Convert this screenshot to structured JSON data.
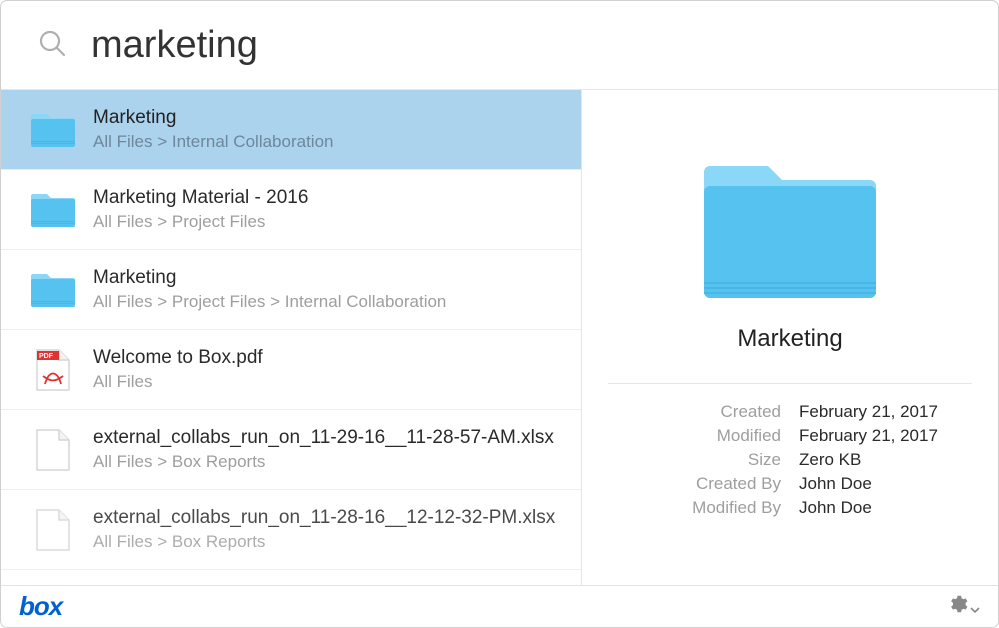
{
  "search": {
    "query": "marketing",
    "placeholder": ""
  },
  "icons": {
    "search": "search-icon",
    "gear": "gear-icon"
  },
  "results": [
    {
      "type": "folder",
      "title": "Marketing",
      "path": "All Files > Internal Collaboration",
      "selected": true
    },
    {
      "type": "folder",
      "title": "Marketing Material - 2016",
      "path": "All Files > Project Files",
      "selected": false
    },
    {
      "type": "folder",
      "title": "Marketing",
      "path": "All Files > Project Files > Internal Collaboration",
      "selected": false
    },
    {
      "type": "pdf",
      "title": "Welcome to Box.pdf",
      "path": "All Files",
      "selected": false
    },
    {
      "type": "file",
      "title": "external_collabs_run_on_11-29-16__11-28-57-AM.xlsx",
      "path": "All Files > Box Reports",
      "selected": false
    },
    {
      "type": "file",
      "title": "external_collabs_run_on_11-28-16__12-12-32-PM.xlsx",
      "path": "All Files > Box Reports",
      "selected": false
    }
  ],
  "preview": {
    "title": "Marketing",
    "meta": {
      "created_label": "Created",
      "created_value": "February 21, 2017",
      "modified_label": "Modified",
      "modified_value": "February 21, 2017",
      "size_label": "Size",
      "size_value": "Zero KB",
      "createdby_label": "Created By",
      "createdby_value": "John Doe",
      "modifiedby_label": "Modified By",
      "modifiedby_value": "John Doe"
    }
  },
  "footer": {
    "brand": "box"
  },
  "colors": {
    "folder_fill": "#6bcbf3",
    "folder_fill_light": "#8bd7f7",
    "selection": "#abd3ee",
    "brand": "#0061d5"
  }
}
